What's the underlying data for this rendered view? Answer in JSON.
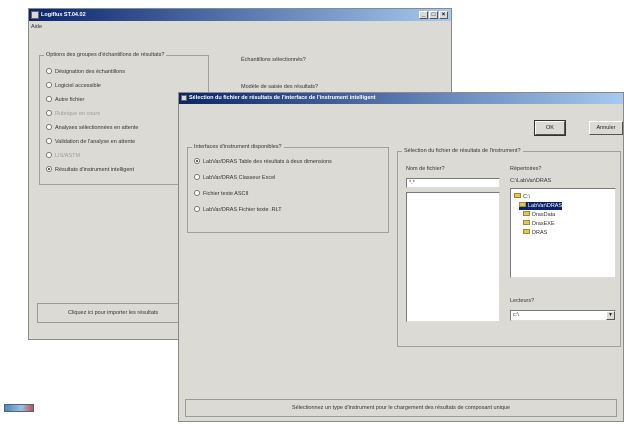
{
  "back_window": {
    "title": "Logiflux ST.04.02",
    "menu": "Aide",
    "group_label": "Options des groupes d'échantillons de résultats?",
    "options": [
      {
        "label": "Désignation des échantillons",
        "enabled": true,
        "checked": false
      },
      {
        "label": "Logiciel accessible",
        "enabled": true,
        "checked": false
      },
      {
        "label": "Autre fichier",
        "enabled": true,
        "checked": false
      },
      {
        "label": "Rubrique en cours",
        "enabled": false,
        "checked": false
      },
      {
        "label": "Analyses sélectionnées en attente",
        "enabled": true,
        "checked": false
      },
      {
        "label": "Validation de l'analyse en attente",
        "enabled": true,
        "checked": false
      },
      {
        "label": "LIS/ASTM",
        "enabled": false,
        "checked": false
      },
      {
        "label": "Résultats d'instrument intelligent",
        "enabled": true,
        "checked": true
      }
    ],
    "right_text_1": "Échantillons sélectionnés?",
    "right_text_2": "Modèle de saisie des résultats?",
    "status_text": "Cliquez ici pour importer les résultats"
  },
  "dialog": {
    "title": "Sélection du fichier de résultats de l'interface de l'instrument intelligent",
    "ok_label": "OK",
    "cancel_label": "Annuler",
    "left_group_label": "Interfaces d'instrument disponibles?",
    "interfaces": [
      {
        "label": "LabVar/DRAS Table des résultats à deux dimensions",
        "checked": true
      },
      {
        "label": "LabVar/DRAS Classeur Excel",
        "checked": false
      },
      {
        "label": "Fichier texte ASCII",
        "checked": false
      },
      {
        "label": "LabVar/DRAS Fichier texte .RLT",
        "checked": false
      }
    ],
    "right_group_label": "Sélection du fichier de résultats de l'instrument?",
    "filename_label": "Nom de fichier?",
    "filename_value": "*.*",
    "directories_label": "Répertoires?",
    "current_path": "C:\\LabVar\\DRAS",
    "tree": [
      {
        "label": "C:\\",
        "selected": false,
        "indent": 0
      },
      {
        "label": "LabVar\\DRAS",
        "selected": true,
        "indent": 1
      },
      {
        "label": "DrasData",
        "selected": false,
        "indent": 2
      },
      {
        "label": "DrasEXE",
        "selected": false,
        "indent": 2
      },
      {
        "label": "DRAS",
        "selected": false,
        "indent": 2
      }
    ],
    "drives_label": "Lecteurs?",
    "drive_value": "c:\\",
    "status_text": "Sélectionnez un type d'instrument pour le chargement des résultats de composant unique"
  },
  "colors": {
    "titlebar_start": "#0a246a",
    "titlebar_end": "#a6caf0",
    "window_face": "#dcdad5",
    "selection": "#0a246a"
  }
}
